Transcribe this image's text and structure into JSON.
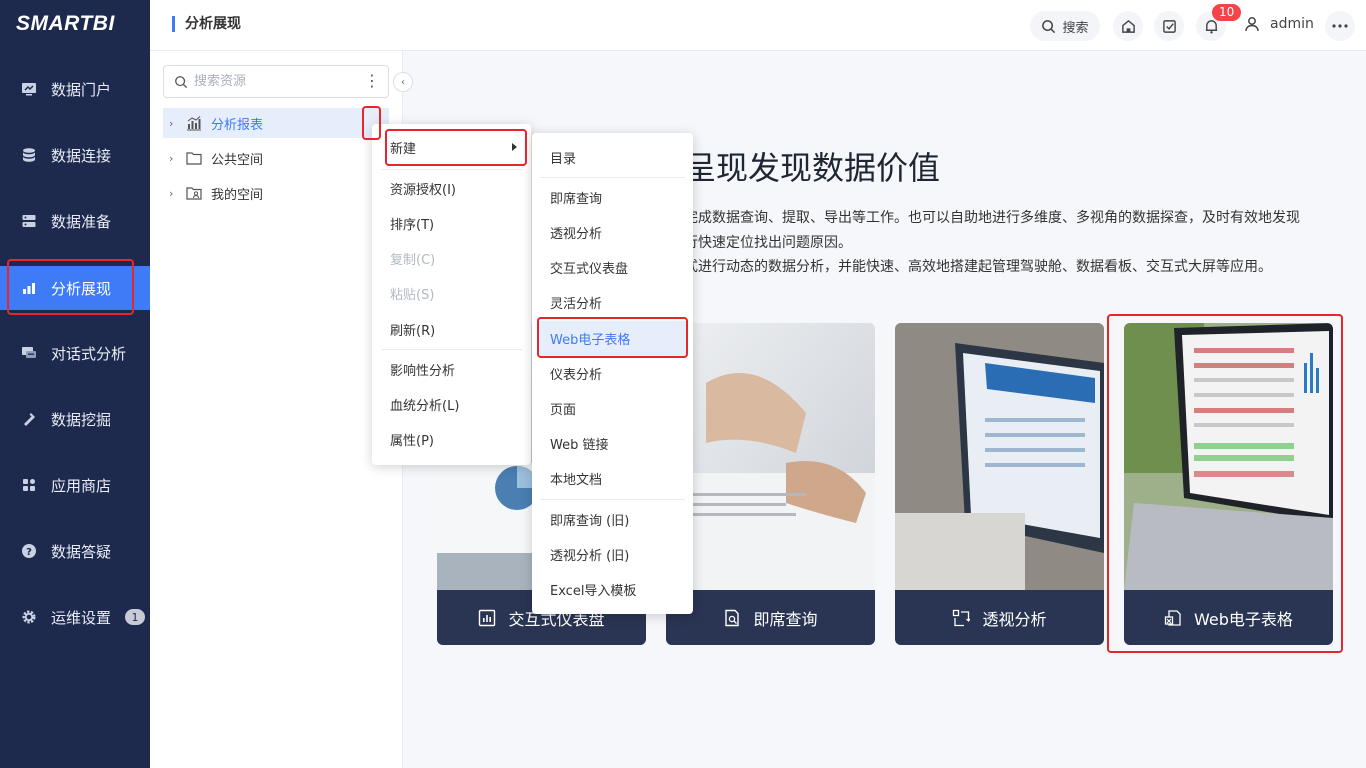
{
  "app": {
    "logo": "SMARTBI"
  },
  "sidebar": {
    "items": [
      {
        "label": "数据门户",
        "icon": "monitor-chart-icon"
      },
      {
        "label": "数据连接",
        "icon": "database-icon"
      },
      {
        "label": "数据准备",
        "icon": "server-icon"
      },
      {
        "label": "分析展现",
        "icon": "bar-chart-icon",
        "active": true
      },
      {
        "label": "对话式分析",
        "icon": "chat-icon"
      },
      {
        "label": "数据挖掘",
        "icon": "pickaxe-icon"
      },
      {
        "label": "应用商店",
        "icon": "apps-icon"
      },
      {
        "label": "数据答疑",
        "icon": "question-icon"
      },
      {
        "label": "运维设置",
        "icon": "gear-icon",
        "badge": "1"
      }
    ]
  },
  "header": {
    "title": "分析展现",
    "search_label": "搜索",
    "notification_count": "10",
    "username": "admin"
  },
  "tree": {
    "search_placeholder": "搜索资源",
    "items": [
      {
        "label": "分析报表",
        "icon": "report-icon",
        "selected": true
      },
      {
        "label": "公共空间",
        "icon": "folder-icon"
      },
      {
        "label": "我的空间",
        "icon": "user-folder-icon"
      }
    ]
  },
  "context_menu": {
    "items": [
      {
        "label": "新建",
        "submenu": true
      },
      {
        "label": "资源授权(I)"
      },
      {
        "label": "排序(T)"
      },
      {
        "label": "复制(C)",
        "disabled": true
      },
      {
        "label": "粘贴(S)",
        "disabled": true
      },
      {
        "label": "刷新(R)"
      },
      {
        "label": "影响性分析"
      },
      {
        "label": "血统分析(L)"
      },
      {
        "label": "属性(P)"
      }
    ]
  },
  "submenu": {
    "items": [
      {
        "label": "目录"
      },
      {
        "label": "即席查询"
      },
      {
        "label": "透视分析"
      },
      {
        "label": "交互式仪表盘"
      },
      {
        "label": "灵活分析"
      },
      {
        "label": "Web电子表格",
        "highlighted": true
      },
      {
        "label": "仪表分析"
      },
      {
        "label": "页面"
      },
      {
        "label": "Web 链接"
      },
      {
        "label": "本地文档"
      },
      {
        "label": "即席查询 (旧)"
      },
      {
        "label": "透视分析 (旧)"
      },
      {
        "label": "Excel导入模板"
      }
    ]
  },
  "main": {
    "hero_title_visible": "呈现发现数据价值",
    "desc_lines": [
      "完成数据查询、提取、导出等工作。也可以自助地进行多维度、多视角的数据探查，及时有效地发现",
      "行快速定位找出问题原因。",
      "式进行动态的数据分析，并能快速、高效地搭建起管理驾驶舱、数据看板、交互式大屏等应用。"
    ],
    "cards": [
      {
        "label": "交互式仪表盘",
        "icon": "dashboard-icon"
      },
      {
        "label": "即席查询",
        "icon": "query-icon"
      },
      {
        "label": "透视分析",
        "icon": "pivot-icon"
      },
      {
        "label": "Web电子表格",
        "icon": "spreadsheet-icon"
      }
    ]
  },
  "colors": {
    "sidebar_bg": "#1d2a4d",
    "accent": "#3d7bf7",
    "highlight_box": "#e5262a"
  }
}
